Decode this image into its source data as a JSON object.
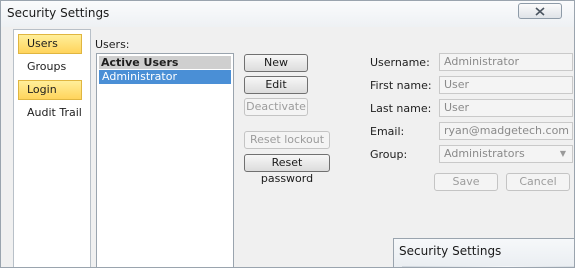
{
  "window": {
    "title": "Security Settings"
  },
  "nav": {
    "items": [
      {
        "label": "Users",
        "active": true
      },
      {
        "label": "Groups",
        "active": false
      },
      {
        "label": "Login",
        "active": true
      },
      {
        "label": "Audit Trail",
        "active": false
      }
    ]
  },
  "users": {
    "label": "Users:",
    "list_header": "Active Users",
    "rows": [
      "Administrator"
    ]
  },
  "buttons": {
    "new": "New",
    "edit": "Edit",
    "deactivate": "Deactivate",
    "reset_lockout": "Reset lockout",
    "reset_password": "Reset password"
  },
  "form": {
    "username": {
      "label": "Username:",
      "value": "Administrator"
    },
    "first_name": {
      "label": "First name:",
      "value": "User"
    },
    "last_name": {
      "label": "Last name:",
      "value": "User"
    },
    "email": {
      "label": "Email:",
      "value": "ryan@madgetech.com"
    },
    "group": {
      "label": "Group:",
      "value": "Administrators"
    },
    "save": "Save",
    "cancel": "Cancel"
  },
  "popup": {
    "title": "Security Settings"
  },
  "icons": {
    "close": "close-icon",
    "dropdown": "chevron-down-icon"
  },
  "colors": {
    "selection": "#4a8fd6",
    "nav_highlight": "#ffd45c"
  }
}
